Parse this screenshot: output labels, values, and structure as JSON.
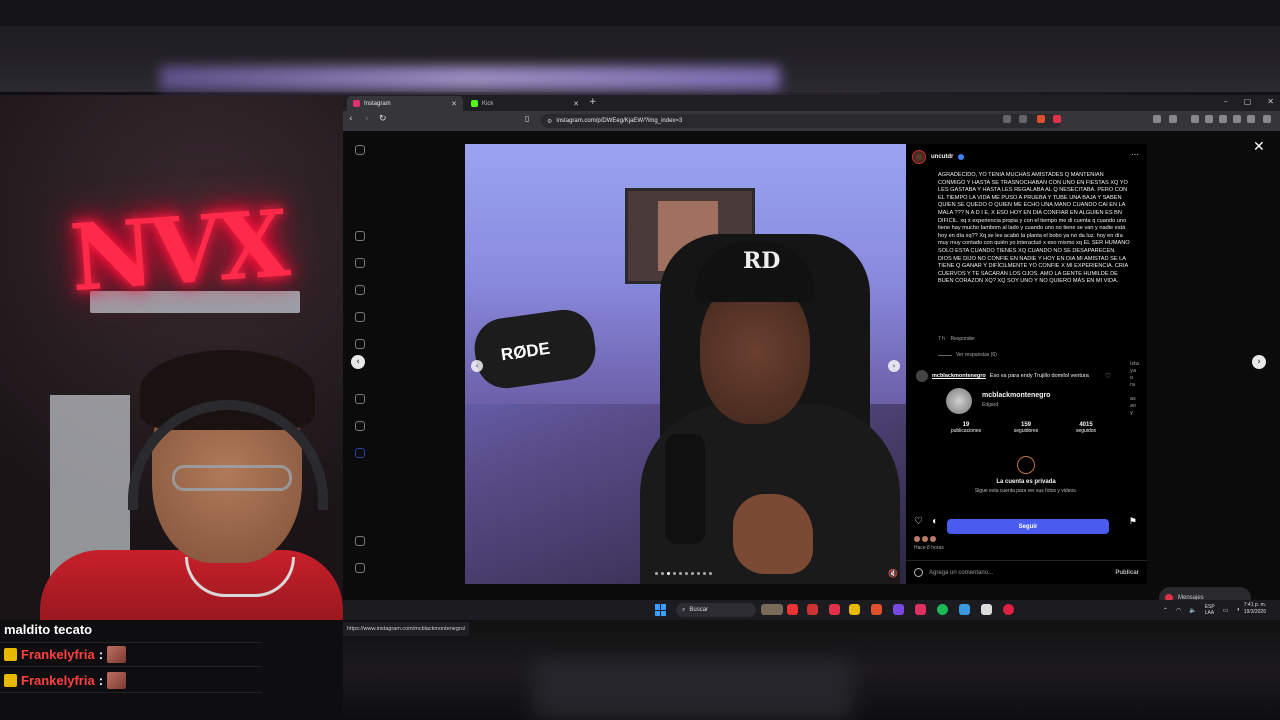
{
  "browser": {
    "tabs": [
      {
        "label": "Instagram",
        "icon": "instagram-icon",
        "color": "#e1306c"
      },
      {
        "label": "Kick",
        "icon": "kick-icon",
        "color": "#53fc18"
      }
    ],
    "url": "instagram.com/p/DWEeg/KjaEW/?img_index=3",
    "status_url": "https://www.instagram.com/mcblackmontenegro/"
  },
  "post": {
    "author": "uncutdr",
    "caption": "AGRADECIDO, YO TENIA MUCHAS AMISTADES Q MANTENIAN CONMIGO Y HASTA SE TRASNOCHABAN CON UNO EN FIESTAS XQ YO LES GASTABA Y HASTA LES REGALABA AL Q NESECITABA. PERO CON EL TIEMPO LA VIDA ME PUSO A PRUEBA Y TUBE UNA BAJA Y SABEN QUIEN SE QUEDO O QUIEN ME ECHO UNA MANO CUANDO CAI EN LA MALA ??? N A D I E, X ESO HOY EN DIA CONFIAR EN ALGUIEN ES BN DIFICIL. xq x experiencia propia y con el tiempo me di cuenta q cuando uno tiene hay mucho Iambom al lado y cuando uno no tiene se van y nadie está hoy en día xq?? Xq se les acabó la planta el bobo ya no da luz. hoy en día muy muy contado con quién yo interactuó x eso mismo xq EL SER HUMANO SOLO ESTA CUANDO TIENES XQ CUANDO NO SE DESAPARECEN. DIOS ME DIJO NO CONFIE EN NADIE Y HOY EN DIA MI AMISTAD SE LA TIENE Q GANAR Y DIFÍCILMENTE YO CONFIE X MI EXPERIENCIA. CRIA CUERVOS Y TE SACARAN LOS OJOS. AMO LA GENTE HUMILDE DE BUEN CORAZON XQ? XQ SOY UNO Y NO QUIERO MÁS EN MI VIDA.",
    "meta_time": "7 h",
    "meta_reply": "Responder",
    "view_replies": "Ver respuestas (6)",
    "comment_user": "mcblackmontenegro",
    "comment_text": "Eso va para endy Trujillo domilol ventura",
    "likes_ago": "Hace 8 horas",
    "comment_placeholder": "Agrega un comentario...",
    "publish": "Publicar",
    "side_strip": [
      "ista",
      "ya",
      "o",
      "ra",
      "",
      "as",
      "an",
      "y"
    ]
  },
  "profile_popup": {
    "username": "mcblackmontenegro",
    "fullname": "Edgard",
    "stats": [
      {
        "value": "19",
        "label": "publicaciones"
      },
      {
        "value": "159",
        "label": "seguidores"
      },
      {
        "value": "4015",
        "label": "seguidos"
      }
    ],
    "private_title": "La cuenta es privada",
    "private_sub": "Sigue esta cuenta para ver sus fotos y videos.",
    "follow_label": "Seguir"
  },
  "media": {
    "mic_brand": "RØDE",
    "cap_logo": "RD",
    "carousel_total": 10,
    "carousel_index": 3
  },
  "messages_pill": "Mensajes",
  "stream": {
    "neon_text": "NVX",
    "chat": [
      {
        "text": "maldito tecato"
      },
      {
        "user": "Frankelyfria",
        "colon": ":"
      },
      {
        "user": "Frankelyfria",
        "colon": ":"
      }
    ]
  },
  "taskbar": {
    "search": "Buscar",
    "lang": "ESP",
    "lang2": "LAA",
    "time": "7:41 p. m.",
    "date": "19/3/2026"
  },
  "colors": {
    "follow_blue": "#4a5cf0",
    "chat_user_red": "#ff4040",
    "neon_red": "#ff2a4a"
  }
}
